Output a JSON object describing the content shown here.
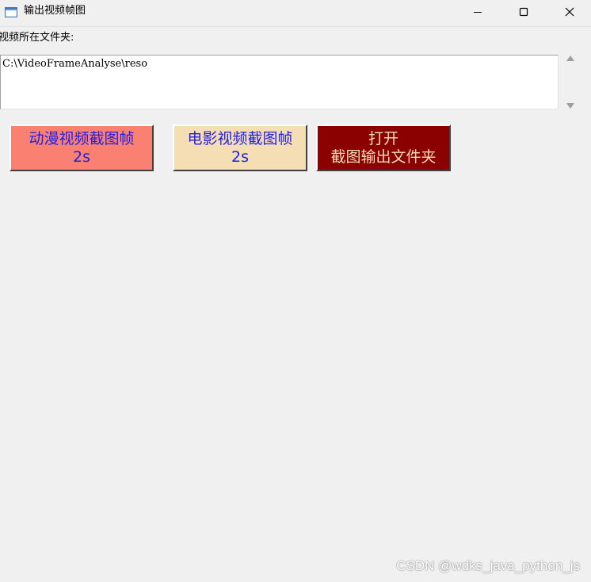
{
  "window": {
    "title": "输出视频帧图",
    "icons": {
      "app": "window-app-icon",
      "minimize": "minimize-icon",
      "maximize": "maximize-icon",
      "close": "close-icon"
    }
  },
  "folder": {
    "label": "视频所在文件夹:",
    "path": "C:\\VideoFrameAnalyse\\reso"
  },
  "buttons": {
    "anime": {
      "line1": "动漫视频截图帧",
      "line2": "2s",
      "bg": "#fa8072",
      "fg": "#1e1ee8"
    },
    "movie": {
      "line1": "电影视频截图帧",
      "line2": "2s",
      "bg": "#f5deb3",
      "fg": "#1e1ee8"
    },
    "open": {
      "line1": "打开",
      "line2": "截图输出文件夹",
      "bg": "#8b0000",
      "fg": "#f5deb3"
    }
  },
  "watermark": "CSDN @wdks_java_python_js"
}
